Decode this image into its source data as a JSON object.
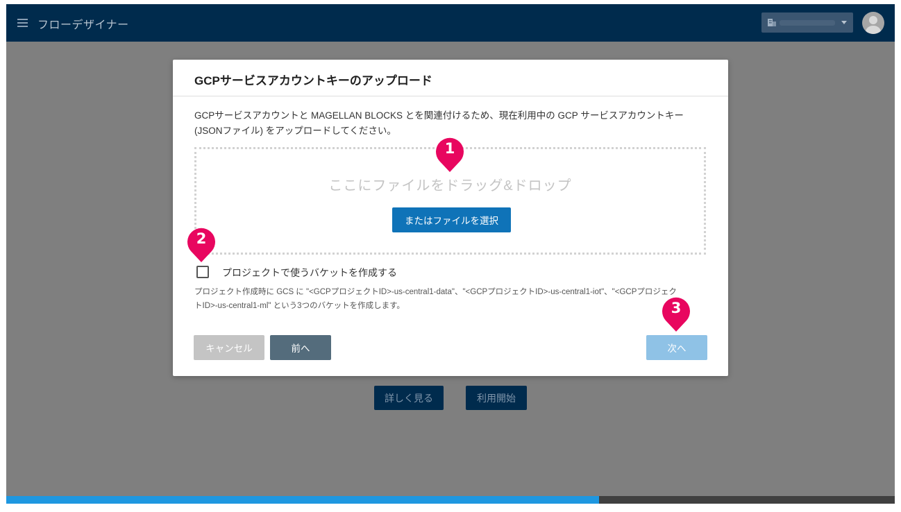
{
  "app": {
    "title": "フローデザイナー"
  },
  "background": {
    "learn_more_label": "詳しく見る",
    "start_label": "利用開始"
  },
  "progress": {
    "fraction": 0.667
  },
  "dialog": {
    "title": "GCPサービスアカウントキーのアップロード",
    "description_line1": "GCPサービスアカウントと MAGELLAN BLOCKS とを関連付けるため、現在利用中の GCP サービスアカウントキー",
    "description_line2": "(JSONファイル) をアップロードしてください。",
    "dropzone_text": "ここにファイルをドラッグ&ドロップ",
    "choose_file_label": "またはファイルを選択",
    "checkbox_label": "プロジェクトで使うバケットを作成する",
    "checkbox_checked": false,
    "note_line1": "プロジェクト作成時に GCS に \"<GCPプロジェクトID>-us-central1-data\"、\"<GCPプロジェクトID>-us-central1-iot\"、\"<GCPプロジェク",
    "note_line2": "トID>-us-central1-ml\" という3つのバケットを作成します。",
    "cancel_label": "キャンセル",
    "prev_label": "前へ",
    "next_label": "次へ"
  },
  "markers": [
    "1",
    "2",
    "3"
  ],
  "colors": {
    "appbar": "#002b4d",
    "primary": "#0f73b8",
    "marker": "#e8065f",
    "progress": "#1e97e0"
  }
}
